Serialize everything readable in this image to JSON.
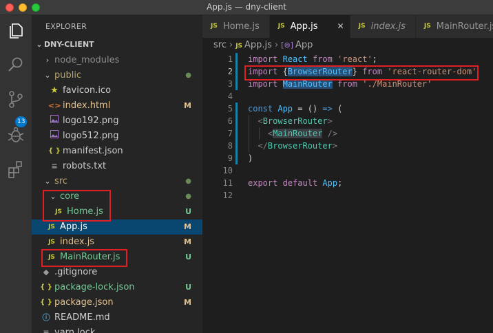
{
  "window": {
    "title": "App.js — dny-client"
  },
  "activity": {
    "scm_badge": "13"
  },
  "sidebar": {
    "header": "EXPLORER",
    "section": "DNY-CLIENT",
    "items": [
      {
        "label": "node_modules",
        "icon": "chevron-right-icon",
        "status": ""
      },
      {
        "label": "public",
        "icon": "chevron-down-icon",
        "status": "●"
      },
      {
        "label": "favicon.ico",
        "icon": "star-icon",
        "status": ""
      },
      {
        "label": "index.html",
        "icon": "html-icon",
        "status": "M"
      },
      {
        "label": "logo192.png",
        "icon": "image-icon",
        "status": ""
      },
      {
        "label": "logo512.png",
        "icon": "image-icon",
        "status": ""
      },
      {
        "label": "manifest.json",
        "icon": "json-icon",
        "status": ""
      },
      {
        "label": "robots.txt",
        "icon": "text-icon",
        "status": ""
      },
      {
        "label": "src",
        "icon": "chevron-down-icon",
        "status": "●"
      },
      {
        "label": "core",
        "icon": "chevron-down-icon",
        "status": "●"
      },
      {
        "label": "Home.js",
        "icon": "js-icon",
        "status": "U"
      },
      {
        "label": "App.js",
        "icon": "js-icon",
        "status": "M"
      },
      {
        "label": "index.js",
        "icon": "js-icon",
        "status": "M"
      },
      {
        "label": "MainRouter.js",
        "icon": "js-icon",
        "status": "U"
      },
      {
        "label": ".gitignore",
        "icon": "git-icon",
        "status": ""
      },
      {
        "label": "package-lock.json",
        "icon": "json-icon",
        "status": "U"
      },
      {
        "label": "package.json",
        "icon": "json-icon",
        "status": "M"
      },
      {
        "label": "README.md",
        "icon": "info-icon",
        "status": ""
      },
      {
        "label": "yarn.lock",
        "icon": "text-icon",
        "status": ""
      }
    ],
    "icon_js": "JS",
    "icon_json": "{ }",
    "icon_html": "<>",
    "icon_star": "★",
    "icon_text": "≡",
    "icon_git": "◆",
    "icon_info": "ⓘ"
  },
  "tabs": [
    {
      "label": "Home.js",
      "active": false
    },
    {
      "label": "App.js",
      "active": true,
      "close": "✕"
    },
    {
      "label": "index.js",
      "active": false
    },
    {
      "label": "MainRouter.js",
      "active": false
    }
  ],
  "breadcrumb": {
    "folder": "src",
    "file": "App.js",
    "symbol": "App"
  },
  "editor": {
    "line_numbers": [
      "1",
      "2",
      "3",
      "4",
      "5",
      "6",
      "7",
      "8",
      "9",
      "10",
      "11",
      "12"
    ],
    "lines": [
      [
        "import",
        " ",
        "React",
        " ",
        "from",
        " ",
        "'react'",
        ";"
      ],
      [
        "import",
        " {",
        "BrowserRouter",
        "} ",
        "from",
        " ",
        "'react-router-dom'"
      ],
      [
        "import",
        " ",
        "MainRouter",
        " ",
        "from",
        " ",
        "'./MainRouter'"
      ],
      [],
      [
        "const",
        " ",
        "App",
        " = () ",
        "=>",
        " ("
      ],
      [
        "<",
        "BrowserRouter",
        ">"
      ],
      [
        "<",
        "MainRouter",
        " />"
      ],
      [
        "</",
        "BrowserRouter",
        ">"
      ],
      [
        ")"
      ],
      [],
      [
        "export",
        " ",
        "default",
        " ",
        "App",
        ";"
      ],
      []
    ]
  },
  "colors": {
    "accent": "#007acc",
    "highlight_box": "#e02020",
    "modified": "#e2c08d",
    "untracked": "#73c991"
  }
}
